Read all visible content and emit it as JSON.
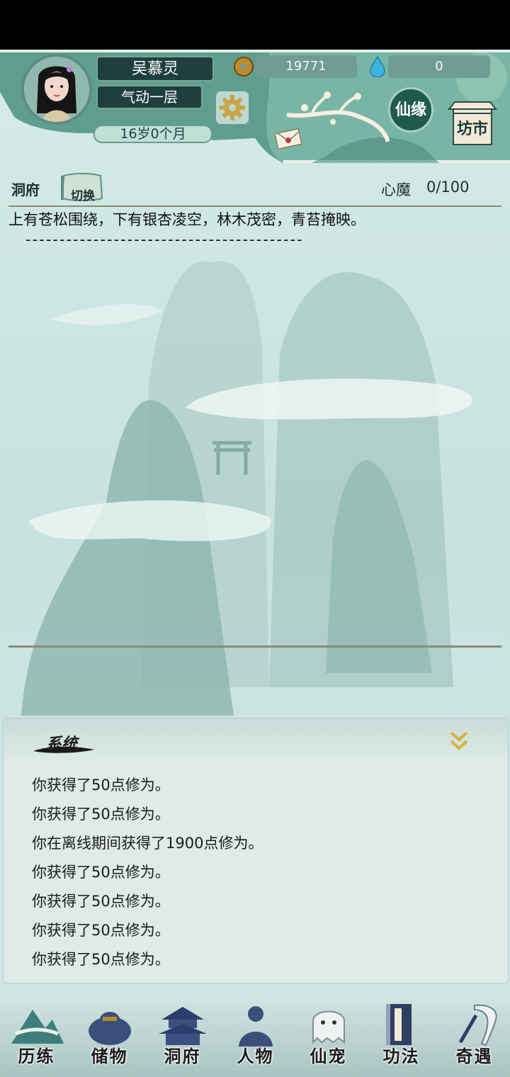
{
  "player": {
    "name": "吴慕灵",
    "realm": "气动一层",
    "age": "16岁0个月"
  },
  "currency": {
    "copper": "19771",
    "spirit": "0"
  },
  "header_buttons": {
    "xianyuan": "仙缘",
    "fangshi": "坊市"
  },
  "cave": {
    "title": "洞府",
    "switch_label": "切换",
    "demon_label": "心魔",
    "demon_value": "0/100",
    "description": "上有苍松围绕，下有银杏凌空，林木茂密，青苔掩映。",
    "divider": "-----------------------------------------"
  },
  "system_log": {
    "title": "系统",
    "entries": [
      "你获得了50点修为。",
      "你获得了50点修为。",
      "你在离线期间获得了1900点修为。",
      "你获得了50点修为。",
      "你获得了50点修为。",
      "你获得了50点修为。",
      "你获得了50点修为。"
    ]
  },
  "nav": [
    {
      "label": "历练",
      "icon": "mountain-icon"
    },
    {
      "label": "储物",
      "icon": "bag-icon"
    },
    {
      "label": "洞府",
      "icon": "pagoda-icon"
    },
    {
      "label": "人物",
      "icon": "person-icon"
    },
    {
      "label": "仙宠",
      "icon": "ghost-pet-icon"
    },
    {
      "label": "功法",
      "icon": "book-icon"
    },
    {
      "label": "奇遇",
      "icon": "scroll-brush-icon"
    }
  ],
  "colors": {
    "panel_dark": "#1f3f3f",
    "header_teal": "#5f9e8e",
    "background": "#cfe6e3"
  }
}
